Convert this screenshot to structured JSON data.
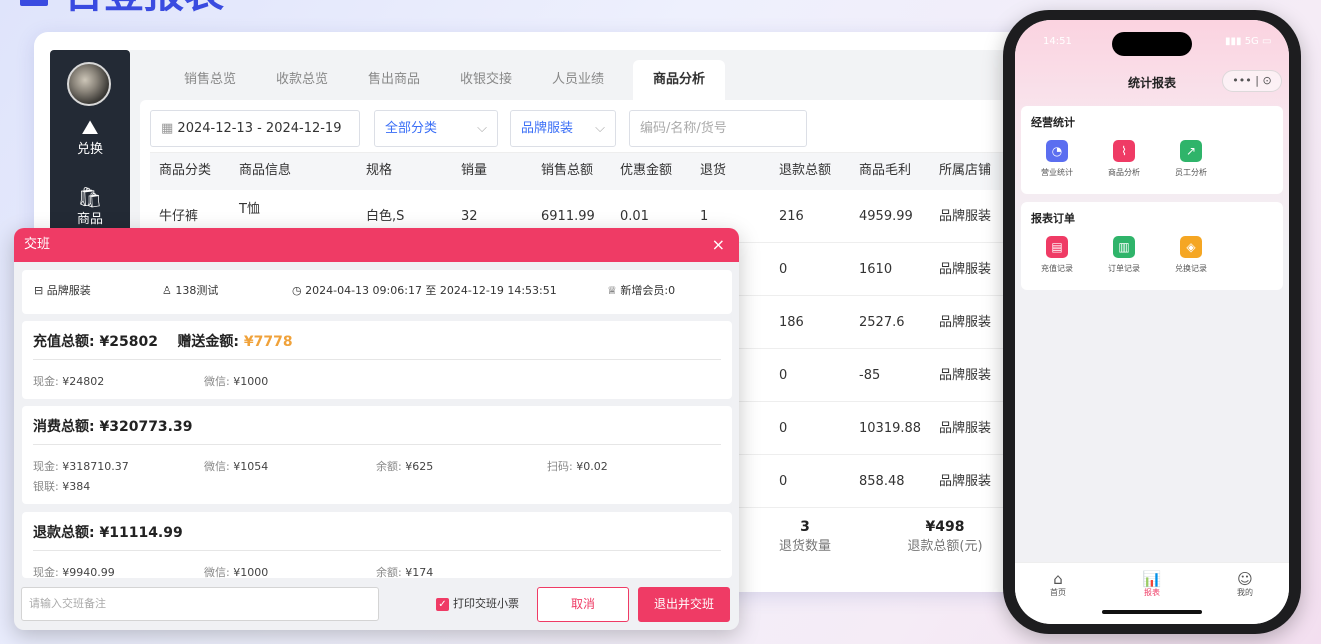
{
  "heading": {
    "title": "台登报表"
  },
  "pos": {
    "side": [
      {
        "icon": "⛰",
        "label": "兑换"
      },
      {
        "icon": "🛍",
        "label": "商品"
      }
    ],
    "tabs": [
      "销售总览",
      "收款总览",
      "售出商品",
      "收银交接",
      "人员业绩",
      "商品分析"
    ],
    "active_tab": "商品分析",
    "filters": {
      "date_range": "2024-12-13 - 2024-12-19",
      "category": "全部分类",
      "store": "品牌服装",
      "search_placeholder": "编码/名称/货号"
    },
    "table": {
      "headers": [
        "商品分类",
        "商品信息",
        "规格",
        "销量",
        "销售总额",
        "优惠金额",
        "退货",
        "退款总额",
        "商品毛利",
        "所属店铺"
      ],
      "rows": [
        {
          "category": "牛仔裤",
          "info": "T恤",
          "spec": "白色,S",
          "qty": "32",
          "total": "6911.99",
          "discount": "0.01",
          "returns": "1",
          "refund": "216",
          "profit": "4959.99",
          "store": "品牌服装"
        },
        {
          "refund": "0",
          "profit": "1610",
          "store": "品牌服装"
        },
        {
          "refund": "186",
          "profit": "2527.6",
          "store": "品牌服装"
        },
        {
          "refund": "0",
          "profit": "-85",
          "store": "品牌服装"
        },
        {
          "refund": "0",
          "profit": "10319.88",
          "store": "品牌服装"
        },
        {
          "refund": "0",
          "profit": "858.48",
          "store": "品牌服装"
        }
      ],
      "summary": [
        {
          "value": "3",
          "label": "退货数量"
        },
        {
          "value": "¥498",
          "label": "退款总额(元)"
        }
      ]
    }
  },
  "dialog": {
    "title": "交班",
    "close": "×",
    "info": {
      "store": "品牌服装",
      "user": "138测试",
      "time": "2024-04-13 09:06:17 至 2024-12-19 14:53:51",
      "members": "新增会员:0"
    },
    "recharge": {
      "total_label": "充值总额:",
      "total": "¥25802",
      "gift_label": "赠送金额:",
      "gift": "¥7778",
      "items": [
        {
          "k": "现金:",
          "v": "¥24802"
        },
        {
          "k": "微信:",
          "v": "¥1000"
        }
      ]
    },
    "consume": {
      "total_label": "消费总额:",
      "total": "¥320773.39",
      "items": [
        {
          "k": "现金:",
          "v": "¥318710.37"
        },
        {
          "k": "微信:",
          "v": "¥1054"
        },
        {
          "k": "余额:",
          "v": "¥625"
        },
        {
          "k": "扫码:",
          "v": "¥0.02"
        },
        {
          "k": "银联:",
          "v": "¥384"
        }
      ]
    },
    "refund": {
      "total_label": "退款总额:",
      "total": "¥11114.99",
      "items": [
        {
          "k": "现金:",
          "v": "¥9940.99"
        },
        {
          "k": "微信:",
          "v": "¥1000"
        },
        {
          "k": "余额:",
          "v": "¥174"
        }
      ]
    },
    "remark_placeholder": "请输入交班备注",
    "print_label": "打印交班小票",
    "cancel": "取消",
    "confirm": "退出并交班"
  },
  "phone": {
    "time": "14:51",
    "signal": "5G",
    "title": "统计报表",
    "capsule_more": "•••",
    "capsule_close": "⊙",
    "sections": [
      {
        "title": "经营统计",
        "items": [
          {
            "label": "营业统计",
            "color": "#5b6ef0"
          },
          {
            "label": "商品分析",
            "color": "#ef3b65"
          },
          {
            "label": "员工分析",
            "color": "#2fb46a"
          }
        ]
      },
      {
        "title": "报表订单",
        "items": [
          {
            "label": "充值记录",
            "color": "#ef3b65"
          },
          {
            "label": "订单记录",
            "color": "#2fb46a"
          },
          {
            "label": "兑换记录",
            "color": "#f5a623"
          }
        ]
      }
    ],
    "tabbar": [
      {
        "label": "首页",
        "icon": "⌂"
      },
      {
        "label": "报表",
        "icon": "📊"
      },
      {
        "label": "我的",
        "icon": "☺"
      }
    ],
    "active_tab": "报表",
    "accent": "#ef3b65"
  }
}
